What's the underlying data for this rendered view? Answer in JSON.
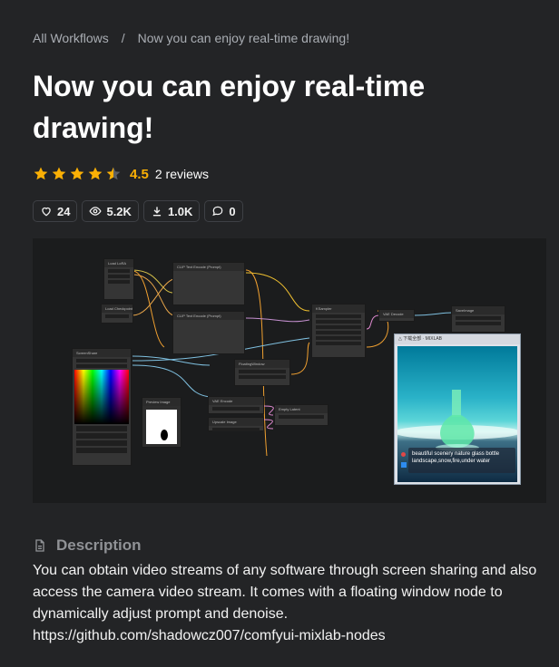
{
  "breadcrumb": {
    "parent": "All Workflows",
    "separator": "/",
    "current": "Now you can enjoy real-time drawing!"
  },
  "title": "Now you can enjoy real-time drawing!",
  "rating": {
    "value": "4.5",
    "stars_out_of_5": 4.5,
    "reviews_label": "2 reviews",
    "star_color": "#fab005"
  },
  "stats": {
    "likes": "24",
    "views": "5.2K",
    "downloads": "1.0K",
    "comments": "0"
  },
  "workflow_preview": {
    "floating_window_prompt": "beautiful scenery nature glass bottle landscape,snow,fire,under water"
  },
  "description": {
    "heading": "Description",
    "body": "You can obtain video streams of any software through screen sharing and also access the camera video stream. It comes with a floating window node to dynamically adjust prompt and denoise. https://github.com/shadowcz007/comfyui-mixlab-nodes"
  },
  "icons": {
    "like": "heart-icon",
    "views": "eye-icon",
    "downloads": "download-icon",
    "comments": "comment-icon",
    "description": "document-icon"
  }
}
